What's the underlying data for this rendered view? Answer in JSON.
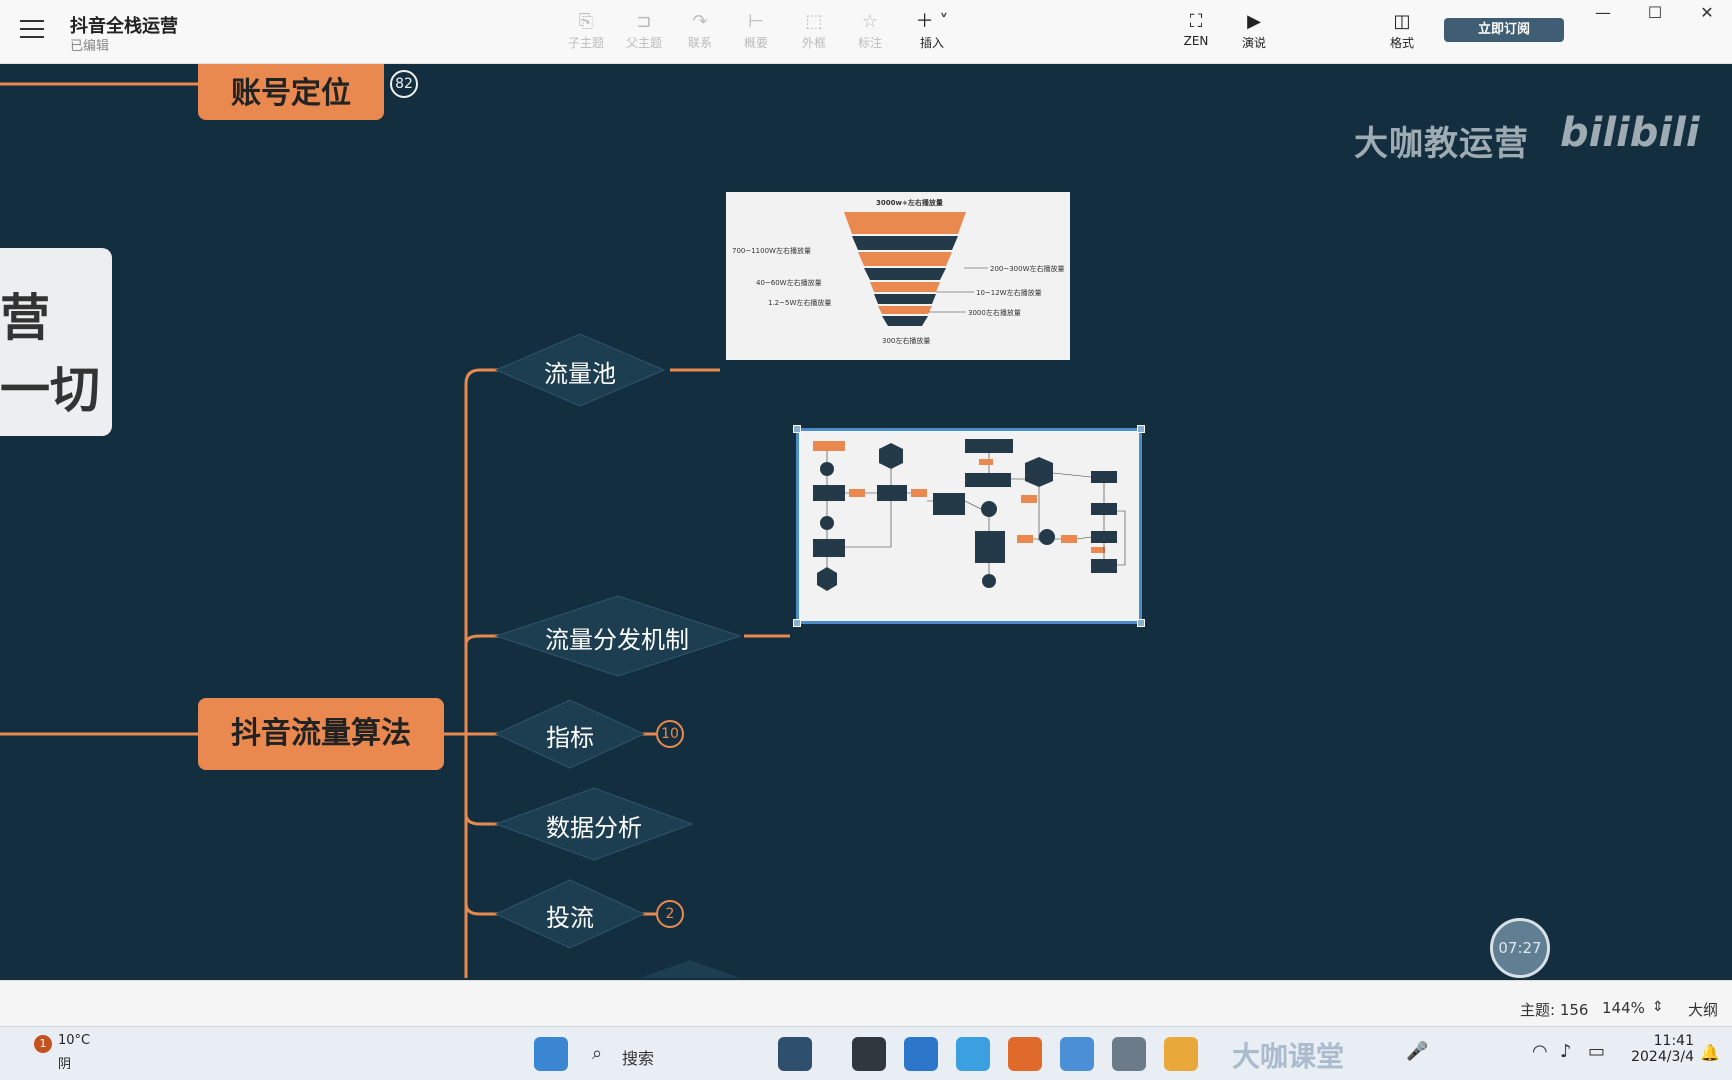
{
  "app": {
    "title": "抖音全栈运营",
    "status": "已编辑"
  },
  "toolbar": {
    "tools": [
      {
        "label": "子主题",
        "icon": "sub-topic-icon"
      },
      {
        "label": "父主题",
        "icon": "parent-topic-icon"
      },
      {
        "label": "联系",
        "icon": "relation-icon"
      },
      {
        "label": "概要",
        "icon": "summary-icon"
      },
      {
        "label": "外框",
        "icon": "boundary-icon"
      },
      {
        "label": "标注",
        "icon": "callout-icon"
      },
      {
        "label": "插入",
        "icon": "plus-icon"
      }
    ],
    "zen_label": "ZEN",
    "present_label": "演说",
    "format_label": "格式",
    "subscribe_label": "立即订阅"
  },
  "watermark": {
    "text": "大咖教运营",
    "logo": "bilibili"
  },
  "mindmap": {
    "root_line1": "营",
    "root_line2": "一切",
    "topics": [
      {
        "label": "账号定位",
        "badge": "82"
      },
      {
        "label": "抖音流量算法"
      }
    ],
    "subtopics": [
      {
        "label": "流量池"
      },
      {
        "label": "流量分发机制"
      },
      {
        "label": "指标",
        "badge": "10"
      },
      {
        "label": "数据分析"
      },
      {
        "label": "投流",
        "badge": "2"
      }
    ],
    "funnel": {
      "top": "3000w+左右播放量",
      "left": [
        "700~1100W左右播放量",
        "40~60W左右播放量",
        "1.2~5W左右播放量"
      ],
      "right": [
        "200~300W左右播放量",
        "10~12W左右播放量",
        "3000左右播放量"
      ],
      "bottom": "300左右播放量"
    }
  },
  "timer": "07:27",
  "statusbar": {
    "topics_label": "主题: 156",
    "zoom": "144%",
    "outline_label": "大纲"
  },
  "taskbar": {
    "weather_temp": "10°C",
    "weather_desc": "阴",
    "weather_badge": "1",
    "search_label": "搜索",
    "watermark": "大咖课堂",
    "time": "11:41",
    "date": "2024/3/4"
  },
  "colors": {
    "canvas": "#132f3f",
    "accent": "#e9894f",
    "toolbar": "#f8f8f8"
  }
}
